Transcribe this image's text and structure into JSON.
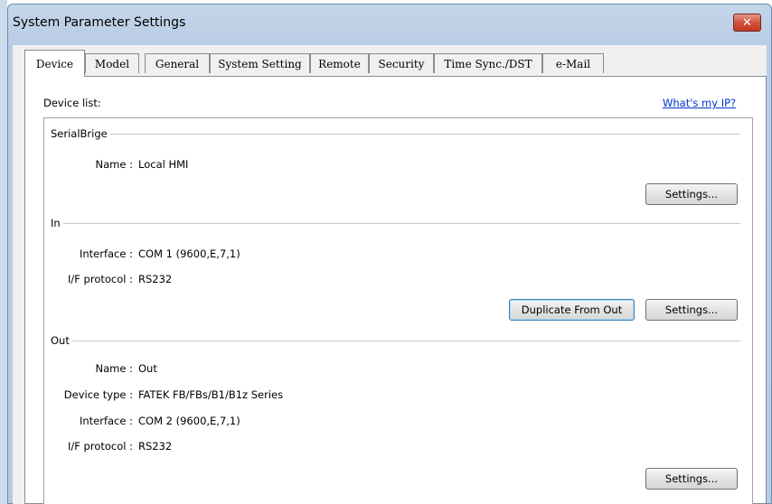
{
  "window": {
    "title": "System Parameter Settings",
    "close_label": "✕"
  },
  "tabs": [
    {
      "label": "Device",
      "active": true
    },
    {
      "label": "Model"
    },
    {
      "label": "General"
    },
    {
      "label": "System Setting"
    },
    {
      "label": "Remote"
    },
    {
      "label": "Security"
    },
    {
      "label": "Time Sync./DST"
    },
    {
      "label": "e-Mail"
    }
  ],
  "device_list": {
    "label": "Device list:",
    "whats_my_ip": "What's my IP?"
  },
  "serial_bridge": {
    "group_title": "SerialBrige",
    "name_label": "Name :",
    "name_value": "Local HMI",
    "settings_button": "Settings..."
  },
  "in": {
    "group_title": "In",
    "interface_label": "Interface :",
    "interface_value": "COM 1 (9600,E,7,1)",
    "protocol_label": "I/F protocol :",
    "protocol_value": "RS232",
    "duplicate_button": "Duplicate From Out",
    "settings_button": "Settings..."
  },
  "out": {
    "group_title": "Out",
    "name_label": "Name :",
    "name_value": "Out",
    "device_type_label": "Device type :",
    "device_type_value": "FATEK FB/FBs/B1/B1z Series",
    "interface_label": "Interface :",
    "interface_value": "COM 2 (9600,E,7,1)",
    "protocol_label": "I/F protocol :",
    "protocol_value": "RS232",
    "settings_button": "Settings..."
  },
  "colors": {
    "link": "#0033cc",
    "close_button": "#c13a22",
    "title_bar": "#b9cde4"
  }
}
